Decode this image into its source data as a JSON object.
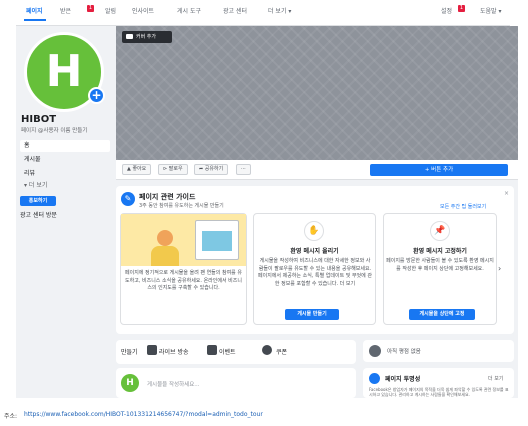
{
  "topnav": {
    "items": [
      "페이지",
      "받은",
      "알림",
      "인사이트",
      "게시 도구",
      "광고 센터",
      "더 보기 ▾"
    ],
    "badge_inbox": "1",
    "settings": "설정",
    "settings_badge": "1",
    "help": "도움말 ▾"
  },
  "cover": {
    "add_cover": "커버 추가"
  },
  "page": {
    "avatar_letter": "H",
    "name": "HIBOT",
    "username_hint": "페이지 @사용자 이름 만들기"
  },
  "leftnav": {
    "items": [
      "홈",
      "게시물",
      "리뷰",
      "▾ 더 보기"
    ],
    "promote": "홍보하기",
    "ad_center": "광고 센터 방문"
  },
  "actions": {
    "like": "좋아요",
    "follow": "팔로우",
    "share": "공유하기",
    "more": "···",
    "add_button": "+ 버튼 추가"
  },
  "guide": {
    "title": "페이지 관련 가이드",
    "subtitle": "3주 동안 참여를 유도하는 게시물 만들기",
    "see_all": "모든 주간 팁 둘러보기",
    "close": "×",
    "card1_text": "페이지에 정기적으로 게시물을 올려 팬 연들의 참여를 유도하고, 비즈니스 소식을 공유하세요. 온라인에서 비즈니스의 인지도를 구축할 수 있습니다.",
    "card2_title": "환영 메시지 올리기",
    "card2_text": "게시물을 작성하여 비즈니스에 대한 자세한 정보와 사람들이 팔로우를 유도할 수 있는 내용을 공유해보세요. 페이지에서 제공하는 소식, 특별 업데이트 및 무엇에 관한 정보를 포함할 수 있습니다. 더 보기",
    "card2_button": "게시물 만들기",
    "card3_title": "환영 메시지 고정하기",
    "card3_text": "페이지를 방문한 사람들이 볼 수 있도록 환영 메시지를 작성한 후 페이지 상단에 고정해보세요.",
    "card3_button": "게시물을 상단에 고정",
    "arrow": "›"
  },
  "postbar": {
    "create": "만들기",
    "live": "라이브 방송",
    "event": "이벤트",
    "offer": "쿠폰"
  },
  "create_post": {
    "placeholder": "게시물을 작성하세요..."
  },
  "right": {
    "card1": "아직 평점 없음",
    "card2_title": "페이지 투명성",
    "card2_more": "더 보기",
    "card2_text": "Facebook은 창업자가 페이지의 목적을 더욱 쉽게 파악할 수 있도록 관련 정보를 표시하고 있습니다. 관리하고 게시하는 사람들을 확인해보세요."
  },
  "status": {
    "label": "주소:",
    "url": "https://www.facebook.com/HIBOT-101331214656747/?modal=admin_todo_tour"
  }
}
